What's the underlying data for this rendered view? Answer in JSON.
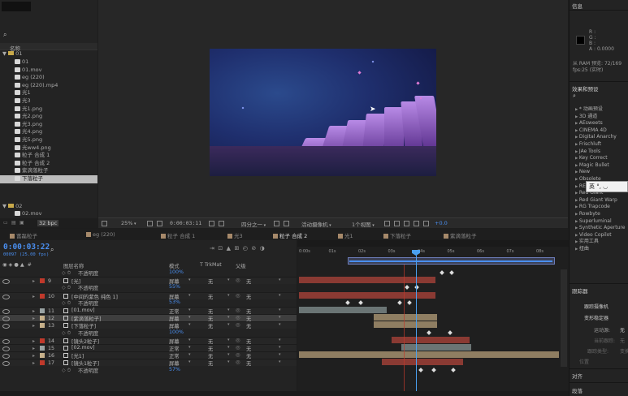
{
  "project": {
    "search_icon": "magnifier-icon",
    "column_name": "名称",
    "folder_top": "01",
    "items": [
      "01",
      "01.mov",
      "eg (220)",
      "eg (220).mp4",
      "光1",
      "光3",
      "光1.png",
      "光2.png",
      "光3.png",
      "光4.png",
      "光5.png",
      "光ww4.png",
      "粒子 合成 1",
      "粒子 合成 2",
      "紫滴落粒子",
      "下落粒子"
    ],
    "selected_item": "下落粒子",
    "folder_bottom": "02",
    "bottom_item": "02.mov",
    "bpc": "32 bpc"
  },
  "viewer": {
    "zoom": "25%",
    "timecode": "0:00:03:11",
    "resolution": "四分之一",
    "camera": "活动摄像机",
    "views": "1个视图",
    "exposure": "+0.0"
  },
  "right_panel": {
    "info_title": "信息",
    "info_rgb": [
      "R :",
      "G :",
      "B :",
      "A : 0.0000"
    ],
    "ram": "从 RAM 预览: 72/169",
    "fps": "fps:25 (实时)",
    "effects_title": "效果和预设",
    "effects": [
      "* 动画预设",
      "3D 通道",
      "AEsweets",
      "CINEMA 4D",
      "Digital Anarchy",
      "Frischluft",
      "JAe Tools",
      "Key Correct",
      "Magic Bullet",
      "New",
      "Obsolete",
      "RE:Vision Plug-ins",
      "Red Giant",
      "Red Giant Warp",
      "RG Trapcode",
      "Rowbyte",
      "Superluminal",
      "Synthetic Aperture",
      "Video Copilot",
      "实用工具",
      "扭曲"
    ],
    "tracker_title": "跟踪器",
    "tracker_btn": "跟踪摄像机",
    "tracker_btn2": "变形稳定器",
    "motion_source_label": "运动源:",
    "motion_source_val": "无",
    "current_track_label": "当前跟踪:",
    "current_track_val": "无",
    "track_type_label": "跟踪类型:",
    "track_type_val": "变换",
    "position_label": "位置",
    "align_title": "对齐",
    "paragraph_title": "段落",
    "ime_text": "英 °, ◡"
  },
  "tabs": [
    "富磊粒子",
    "eg (220)",
    "粒子 合成 1",
    "光3",
    "粒子 合成 2",
    "光1",
    "下落粒子",
    "紫滴落粒子"
  ],
  "active_tab": "粒子 合成 2",
  "timeline": {
    "timecode": "0:00:03:22",
    "timecode_sub": "00097 (25.00 fps)",
    "col_name": "图层名称",
    "col_mode": "模式",
    "col_trkmat": "T TrkMat",
    "col_parent": "父级",
    "ruler": [
      "0:00s",
      "01s",
      "02s",
      "03s",
      "04s",
      "05s",
      "06s",
      "07s",
      "08s"
    ],
    "rows": [
      {
        "kind": "prop",
        "name": "不透明度",
        "value": "100%"
      },
      {
        "kind": "layer",
        "num": "9",
        "name": "[光]",
        "mode": "屏幕",
        "trk": "无",
        "parent": "无",
        "color": "#c0392b"
      },
      {
        "kind": "prop",
        "name": "不透明度",
        "value": "55%"
      },
      {
        "kind": "layer",
        "num": "10",
        "name": "[中间的紫色 纯色 1]",
        "mode": "屏幕",
        "trk": "无",
        "parent": "无",
        "color": "#c0392b"
      },
      {
        "kind": "prop",
        "name": "不透明度",
        "value": "53%"
      },
      {
        "kind": "layer",
        "num": "11",
        "name": "[01.mov]",
        "mode": "正常",
        "trk": "无",
        "parent": "无",
        "color": "#9aa3a3"
      },
      {
        "kind": "layer",
        "num": "12",
        "name": "[紫滴落粒子]",
        "mode": "屏幕",
        "trk": "无",
        "parent": "无",
        "color": "#c6b08a",
        "selected": true
      },
      {
        "kind": "layer",
        "num": "13",
        "name": "[下落粒子]",
        "mode": "屏幕",
        "trk": "无",
        "parent": "无",
        "color": "#c6b08a"
      },
      {
        "kind": "prop",
        "name": "不透明度",
        "value": "100%"
      },
      {
        "kind": "layer",
        "num": "14",
        "name": "[镜头2粒子]",
        "mode": "屏幕",
        "trk": "无",
        "parent": "无",
        "color": "#c0392b"
      },
      {
        "kind": "layer",
        "num": "15",
        "name": "[02.mov]",
        "mode": "正常",
        "trk": "无",
        "parent": "无",
        "color": "#9aa3a3"
      },
      {
        "kind": "layer",
        "num": "16",
        "name": "[光1]",
        "mode": "正常",
        "trk": "无",
        "parent": "无",
        "color": "#c6b08a"
      },
      {
        "kind": "layer",
        "num": "17",
        "name": "[镜头1粒子]",
        "mode": "屏幕",
        "trk": "无",
        "parent": "无",
        "color": "#c0392b"
      },
      {
        "kind": "prop",
        "name": "不透明度",
        "value": "57%"
      }
    ]
  }
}
